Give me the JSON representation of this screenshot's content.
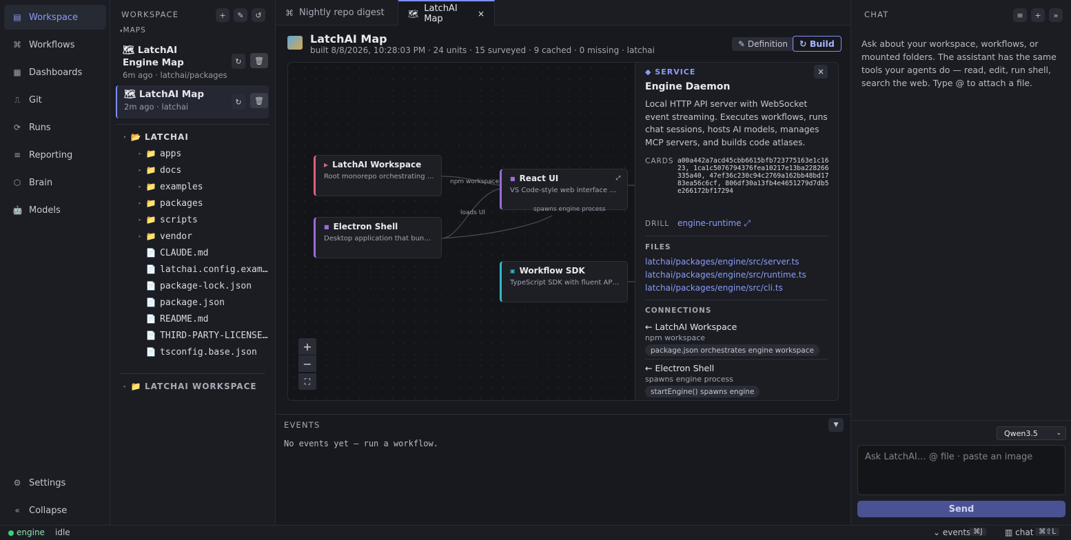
{
  "nav": {
    "items": [
      {
        "label": "Workspace",
        "icon": "▤"
      },
      {
        "label": "Workflows",
        "icon": "⌘"
      },
      {
        "label": "Dashboards",
        "icon": "▦"
      },
      {
        "label": "Git",
        "icon": "⎍"
      },
      {
        "label": "Runs",
        "icon": "⟳"
      },
      {
        "label": "Reporting",
        "icon": "≡"
      },
      {
        "label": "Brain",
        "icon": "⬡"
      },
      {
        "label": "Models",
        "icon": "🤖"
      }
    ],
    "settings": "Settings",
    "collapse": "Collapse"
  },
  "workspace": {
    "header": "WORKSPACE",
    "maps_header": "MAPS",
    "maps": [
      {
        "title": "LatchAI Engine Map",
        "sub": "6m ago · latchai/packages"
      },
      {
        "title": "LatchAI Map",
        "sub": "2m ago · latchai"
      }
    ],
    "tree_root": "LATCHAI",
    "folders": [
      "apps",
      "docs",
      "examples",
      "packages",
      "scripts",
      "vendor"
    ],
    "files": [
      "CLAUDE.md",
      "latchai.config.exam…",
      "package-lock.json",
      "package.json",
      "README.md",
      "THIRD-PARTY-LICENSE…",
      "tsconfig.base.json"
    ],
    "second_root": "LATCHAI WORKSPACE"
  },
  "tabs": [
    {
      "label": "Nightly repo digest",
      "icon": "⌘"
    },
    {
      "label": "LatchAI Map",
      "icon": "🗺",
      "close": "×"
    }
  ],
  "header": {
    "title": "LatchAI Map",
    "subtitle": "built 8/8/2026, 10:28:03 PM · 24 units · 15 surveyed · 9 cached · 0 missing · latchai",
    "definition_label": "✎ Definition",
    "build_label": "↻ Build"
  },
  "graph": {
    "nodes": [
      {
        "title": "LatchAI Workspace",
        "desc": "Root monorepo orchestrating npm …",
        "color": "#e0607e"
      },
      {
        "title": "Electron Shell",
        "desc": "Desktop application that bundles th…",
        "color": "#9d6cd8"
      },
      {
        "title": "React UI",
        "desc": "VS Code-style web interface with w…",
        "color": "#9d6cd8"
      },
      {
        "title": "Workflow SDK",
        "desc": "TypeScript SDK with fluent API (Wo…",
        "color": "#35b8c9"
      }
    ],
    "edge_labels": [
      "npm workspace",
      "loads UI",
      "spawns engine process"
    ],
    "zoom_in": "+",
    "zoom_out": "−",
    "fit": "⛶"
  },
  "detail": {
    "kind": "SERVICE",
    "title": "Engine Daemon",
    "description": "Local HTTP API server with WebSocket event streaming. Executes workflows, runs chat sessions, hosts AI models, manages MCP servers, and builds code atlases.",
    "cards_label": "CARDS",
    "cards": "a00a442a7acd45cbb6615bfb723775163e1c1623, 1ca1c5076794376fea10217e13ba228266335a40, 47ef36c230c94c2769a162bb48bd1783ea56c6cf, 806df30a13fb4e4651279d7db5e266172bf17294",
    "drill_label": "DRILL",
    "drill": "engine-runtime ⤢",
    "files_label": "FILES",
    "files": [
      "latchai/packages/engine/src/server.ts",
      "latchai/packages/engine/src/runtime.ts",
      "latchai/packages/engine/src/cli.ts"
    ],
    "connections_label": "CONNECTIONS",
    "connections": [
      {
        "title": "← LatchAI Workspace",
        "sub": "npm workspace",
        "pill": "package.json orchestrates engine workspace"
      },
      {
        "title": "← Electron Shell",
        "sub": "spawns engine process",
        "pill": "startEngine() spawns engine"
      }
    ]
  },
  "events": {
    "header": "EVENTS",
    "empty": "No events yet — run a workflow."
  },
  "chat": {
    "header": "CHAT",
    "intro": "Ask about your workspace, workflows, or mounted folders. The assistant has the same tools your agents do — read, edit, run shell, search the web. Type @ to attach a file.",
    "model": "Qwen3.5",
    "placeholder": "Ask LatchAI… @ file · paste an image",
    "send": "Send"
  },
  "status": {
    "engine": "engine",
    "state": "idle",
    "events": "⌄ events",
    "events_kbd": "⌘J",
    "chat": "▥ chat",
    "chat_kbd": "⌘⇧L"
  },
  "colors": {
    "accent": "#7f8ff4",
    "online": "#3ad07a"
  }
}
